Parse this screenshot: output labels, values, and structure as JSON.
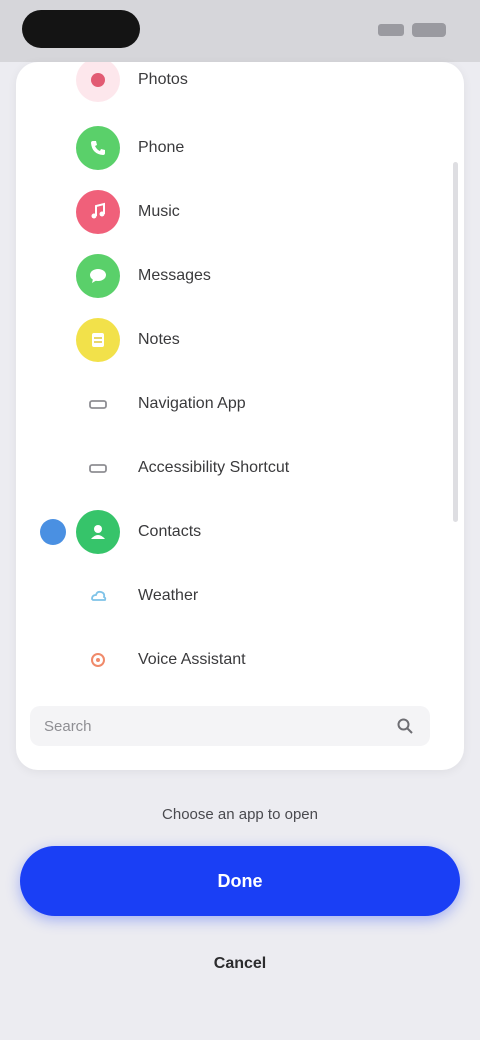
{
  "list": {
    "items": [
      {
        "label": "Photos",
        "icon": "photos-icon",
        "color": "#e25b73"
      },
      {
        "label": "Phone",
        "icon": "phone-icon",
        "color": "#5ad06a"
      },
      {
        "label": "Music",
        "icon": "music-icon",
        "color": "#f0607a"
      },
      {
        "label": "Messages",
        "icon": "messages-icon",
        "color": "#5ad06a"
      },
      {
        "label": "Notes",
        "icon": "notes-icon",
        "color": "#f2e14a"
      },
      {
        "label": "Navigation App",
        "icon": "navigation-icon",
        "color": "#8e8e93"
      },
      {
        "label": "Accessibility Shortcut",
        "icon": "accessibility-icon",
        "color": "#8e8e93"
      },
      {
        "label": "Contacts",
        "icon": "contacts-icon",
        "color": "#36c46a",
        "selected": true
      },
      {
        "label": "Weather",
        "icon": "weather-icon",
        "color": "#7fc3e8"
      },
      {
        "label": "Voice Assistant",
        "icon": "assistant-icon",
        "color": "#f08a6a"
      }
    ]
  },
  "field": {
    "placeholder": "Search"
  },
  "footer": {
    "hint": "Choose an app to open",
    "primary_label": "Done",
    "secondary_label": "Cancel"
  },
  "colors": {
    "accent": "#1a3ff5",
    "radio": "#4a90e2",
    "background": "#ececf1"
  }
}
